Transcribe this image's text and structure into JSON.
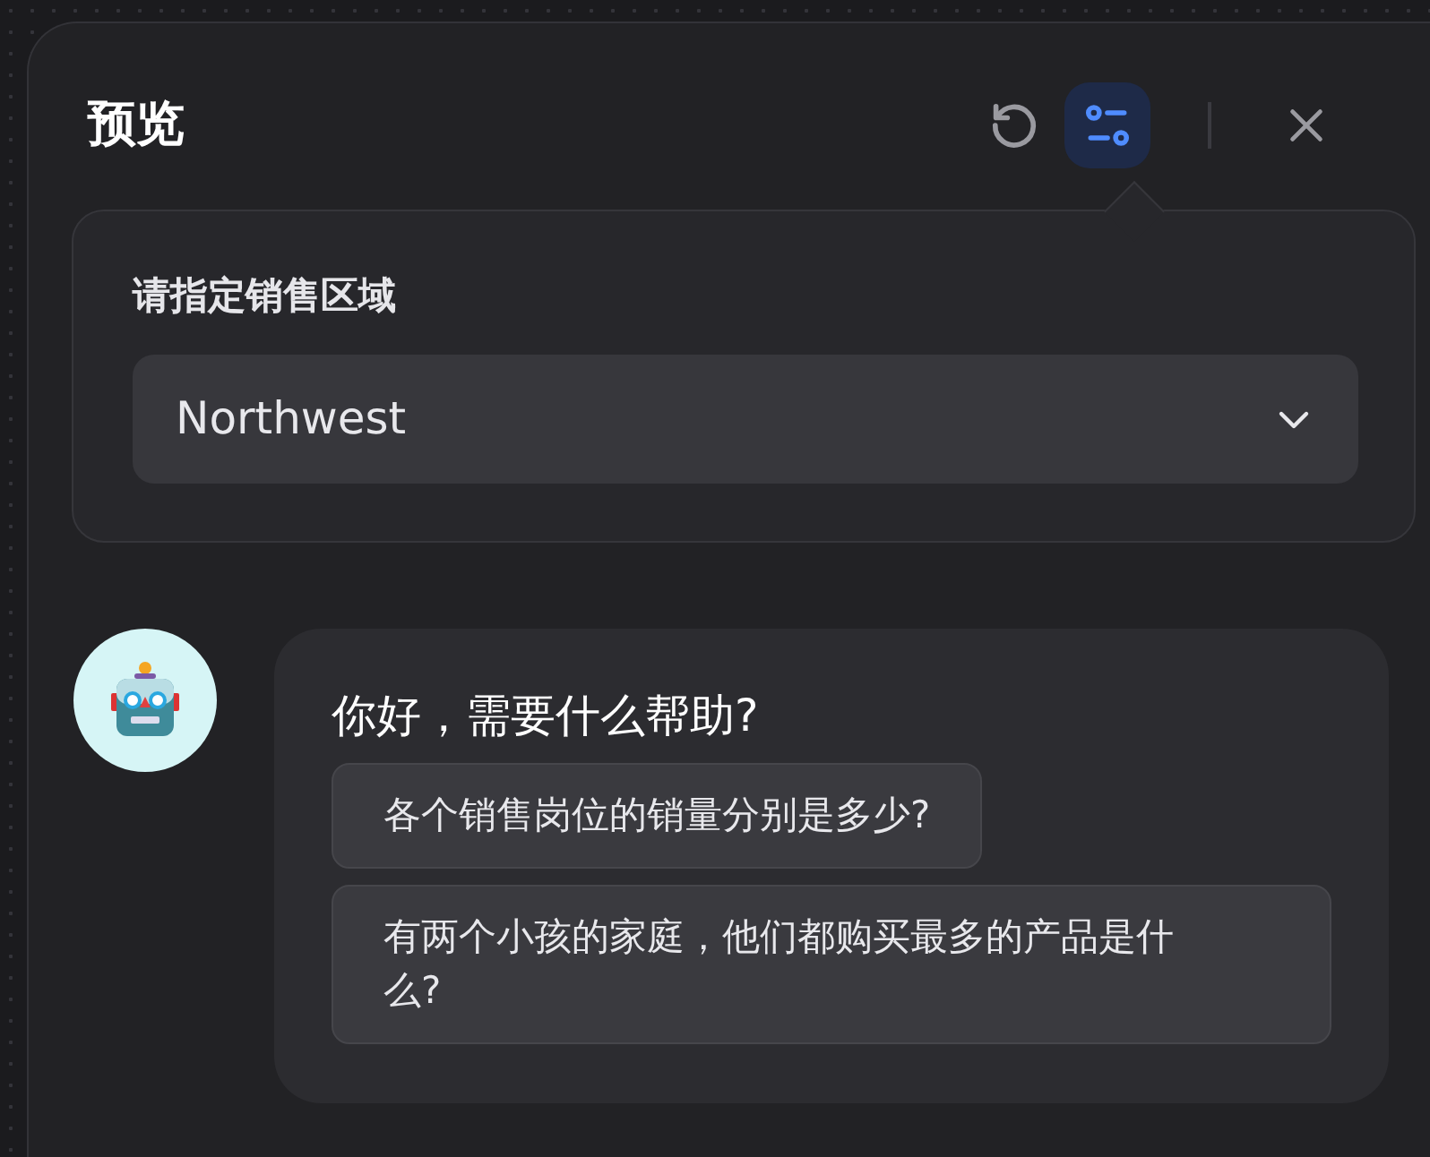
{
  "header": {
    "title": "预览",
    "settings_selected": true
  },
  "settings": {
    "label": "请指定销售区域",
    "value": "Northwest"
  },
  "chat": {
    "message": "你好，需要什么帮助?",
    "suggestions": [
      {
        "text": "各个销售岗位的销量分别是多少?"
      },
      {
        "text": "有两个小孩的家庭，他们都购买最多的产品是什么?"
      }
    ]
  }
}
